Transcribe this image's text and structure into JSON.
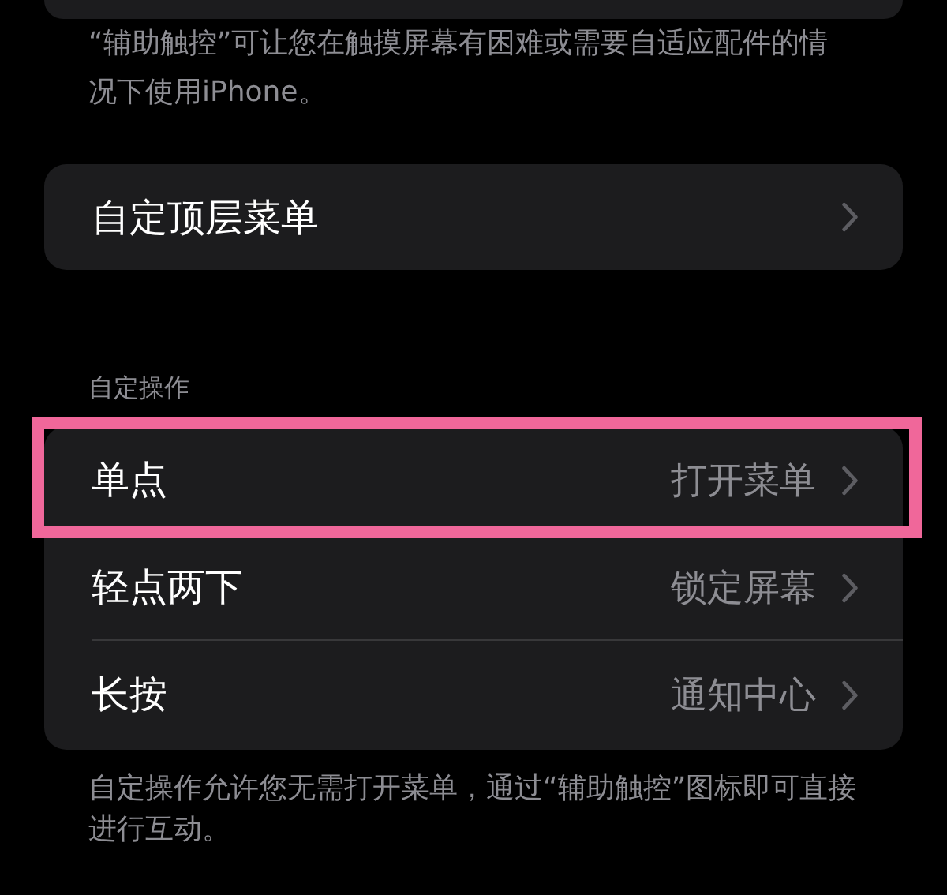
{
  "intro_note": "“辅助触控”可让您在触摸屏幕有困难或需要自适应配件的情况下使用iPhone。",
  "top_menu": {
    "label": "自定顶层菜单"
  },
  "custom_actions": {
    "header": "自定操作",
    "rows": [
      {
        "label": "单点",
        "value": "打开菜单",
        "highlighted": true
      },
      {
        "label": "轻点两下",
        "value": "锁定屏幕",
        "highlighted": false
      },
      {
        "label": "长按",
        "value": "通知中心",
        "highlighted": false
      }
    ],
    "footer": "自定操作允许您无需打开菜单，通过“辅助触控”图标即可直接进行互动。"
  }
}
